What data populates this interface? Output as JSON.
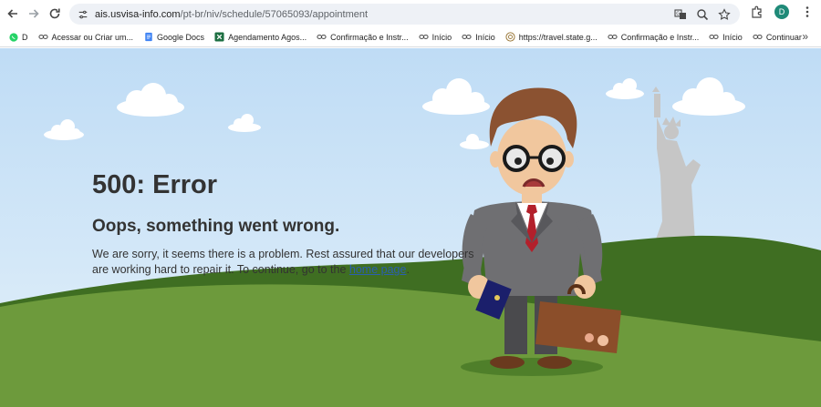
{
  "browser": {
    "url_host": "ais.usvisa-info.com",
    "url_path": "/pt-br/niv/schedule/57065093/appointment",
    "avatar_letter": "D",
    "icons": [
      "back-icon",
      "forward-icon",
      "reload-icon",
      "site-info-icon",
      "translate-icon",
      "zoom-icon",
      "star-icon",
      "extensions-icon",
      "menu-icon"
    ]
  },
  "bookmarks": [
    {
      "label": "D",
      "icon": "whatsapp-icon"
    },
    {
      "label": "Acessar ou Criar um...",
      "icon": "link-icon"
    },
    {
      "label": "Google Docs",
      "icon": "docs-icon"
    },
    {
      "label": "Agendamento Agos...",
      "icon": "sheets-icon"
    },
    {
      "label": "Confirmação e Instr...",
      "icon": "link-icon"
    },
    {
      "label": "Início",
      "icon": "link-icon"
    },
    {
      "label": "Início",
      "icon": "link-icon"
    },
    {
      "label": "https://travel.state.g...",
      "icon": "globe-icon"
    },
    {
      "label": "Confirmação e Instr...",
      "icon": "link-icon"
    },
    {
      "label": "Início",
      "icon": "link-icon"
    },
    {
      "label": "Continuar",
      "icon": "link-icon"
    }
  ],
  "error": {
    "title": "500: Error",
    "subtitle": "Oops, something went wrong.",
    "message_before": "We are sorry, it seems there is a problem. Rest assured that our developers are working hard to repair it. To continue, go to the ",
    "link_text": "home page",
    "message_after": "."
  },
  "colors": {
    "sky": "#cfe5f7",
    "hill_dark": "#3f6e22",
    "hill_light": "#6d9a3c",
    "link": "#2a5fb0",
    "passport": "#1b1f6b",
    "briefcase": "#8b4e2a"
  }
}
